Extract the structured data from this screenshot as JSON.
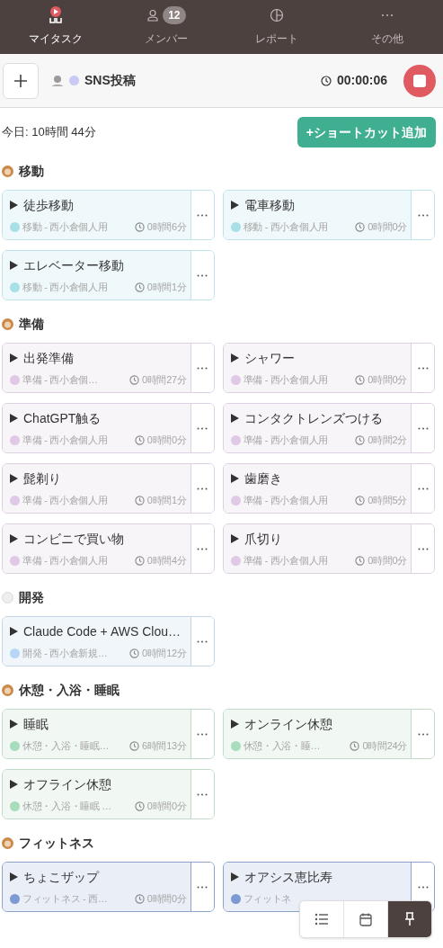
{
  "nav": [
    {
      "label": "マイタスク",
      "selected": true
    },
    {
      "label": "メンバー",
      "badge": "12",
      "selected": false
    },
    {
      "label": "レポート",
      "selected": false
    },
    {
      "label": "その他",
      "selected": false
    }
  ],
  "timer": {
    "task": "SNS投稿",
    "elapsed": "00:00:06",
    "running": true
  },
  "today": "今日: 10時間 44分",
  "shortcut_button": "+ショートカット追加",
  "groups": [
    {
      "name": "移動",
      "kind": "photo",
      "color": "#a9e0e8",
      "cards": [
        {
          "title": "徒歩移動",
          "project": "移動 - 西小倉個人用",
          "time": "0時間6分"
        },
        {
          "title": "電車移動",
          "project": "移動 - 西小倉個人用",
          "time": "0時間0分"
        },
        {
          "title": "エレベーター移動",
          "project": "移動 - 西小倉個人用",
          "time": "0時間1分"
        }
      ]
    },
    {
      "name": "準備",
      "kind": "photo",
      "color": "#e0c9e6",
      "cards": [
        {
          "title": "出発準備",
          "project": "準備 - 西小倉個…",
          "time": "0時間27分"
        },
        {
          "title": "シャワー",
          "project": "準備 - 西小倉個人用",
          "time": "0時間0分"
        },
        {
          "title": "ChatGPT触る",
          "project": "準備 - 西小倉個人用",
          "time": "0時間0分"
        },
        {
          "title": "コンタクトレンズつける",
          "project": "準備 - 西小倉個人用",
          "time": "0時間2分"
        },
        {
          "title": "髭剃り",
          "project": "準備 - 西小倉個人用",
          "time": "0時間1分"
        },
        {
          "title": "歯磨き",
          "project": "準備 - 西小倉個人用",
          "time": "0時間5分"
        },
        {
          "title": "コンビニで買い物",
          "project": "準備 - 西小倉個人用",
          "time": "0時間4分"
        },
        {
          "title": "爪切り",
          "project": "準備 - 西小倉個人用",
          "time": "0時間0分"
        }
      ]
    },
    {
      "name": "開発",
      "kind": "blank",
      "color": "#b8d6f5",
      "cards": [
        {
          "title": "Claude Code + AWS Clou…",
          "project": "開発 - 西小倉新規…",
          "time": "0時間12分"
        }
      ]
    },
    {
      "name": "休憩・入浴・睡眠",
      "kind": "photo",
      "color": "#a7dcbd",
      "cards": [
        {
          "title": "睡眠",
          "project": "休憩・入浴・睡眠…",
          "time": "6時間13分"
        },
        {
          "title": "オンライン休憩",
          "project": "休憩・入浴・睡…",
          "time": "0時間24分"
        },
        {
          "title": "オフライン休憩",
          "project": "休憩・入浴・睡眠 …",
          "time": "0時間0分"
        }
      ]
    },
    {
      "name": "フィットネス",
      "kind": "photo",
      "color": "#7d9bd2",
      "cards": [
        {
          "title": "ちょこザップ",
          "project": "フィットネス - 西…",
          "time": "0時間0分"
        },
        {
          "title": "オアシス恵比寿",
          "project": "フィットネ"
        }
      ]
    }
  ],
  "view_switcher": [
    {
      "selected": false
    },
    {
      "selected": false
    },
    {
      "selected": true
    }
  ]
}
